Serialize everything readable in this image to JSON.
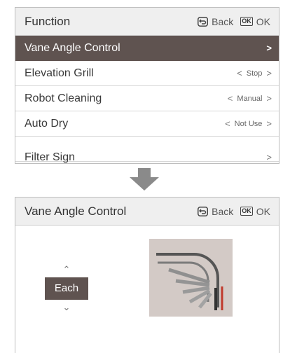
{
  "top": {
    "title": "Function",
    "back_label": "Back",
    "ok_label": "OK",
    "ok_icon_text": "OK",
    "items": [
      {
        "label": "Vane Angle Control",
        "value": "",
        "selected": true
      },
      {
        "label": "Elevation Grill",
        "value": "Stop"
      },
      {
        "label": "Robot Cleaning",
        "value": "Manual"
      },
      {
        "label": "Auto Dry",
        "value": "Not Use"
      },
      {
        "label": "Filter Sign",
        "value": ""
      }
    ]
  },
  "bottom": {
    "title": "Vane Angle Control",
    "back_label": "Back",
    "ok_label": "OK",
    "ok_icon_text": "OK",
    "mode_value": "Each"
  },
  "colors": {
    "selected_bg": "#5f5350",
    "header_bg": "#efefef",
    "vane_preview_bg": "#d3cac6",
    "arrow": "#8a8a8a"
  },
  "icons": {
    "back": "back-arrow-icon",
    "ok": "ok-icon",
    "flow": "down-arrow-icon",
    "vane": "vane-illustration"
  }
}
